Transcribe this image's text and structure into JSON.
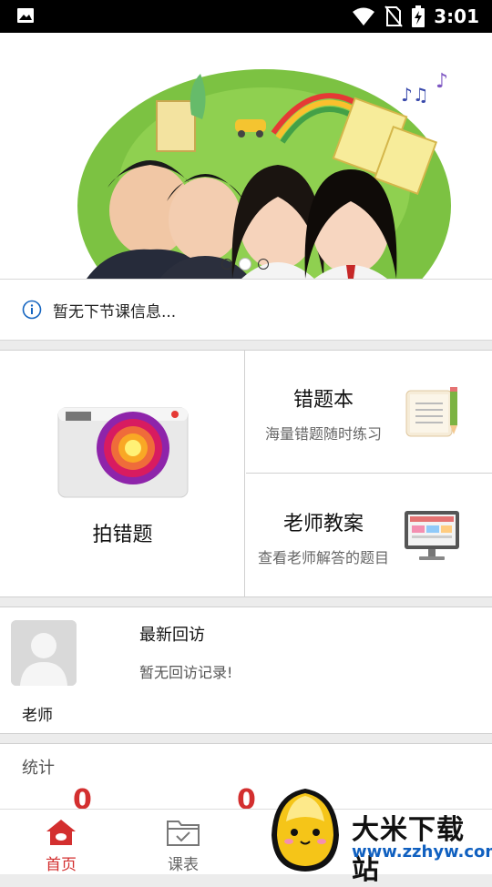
{
  "status_bar": {
    "time": "3:01",
    "icons": [
      "image-icon",
      "wifi-icon",
      "no-sim-icon",
      "battery-charging-icon"
    ]
  },
  "banner": {
    "slides": 3,
    "active_slide_index": 1,
    "image": "students-banner-illustration"
  },
  "next_class": {
    "icon": "info-icon",
    "text": "暂无下节课信息..."
  },
  "features": {
    "photo_mistakes": {
      "label": "拍错题",
      "icon": "camera-icon"
    },
    "mistake_book": {
      "title": "错题本",
      "subtitle": "海量错题随时练习",
      "icon": "notebook-icon"
    },
    "teacher_plans": {
      "title": "老师教案",
      "subtitle": "查看老师解答的题目",
      "icon": "monitor-icon"
    }
  },
  "visit": {
    "teacher_label": "老师",
    "title": "最新回访",
    "empty_text": "暂无回访记录!"
  },
  "stats": {
    "title": "统计",
    "values": [
      "0",
      "0"
    ]
  },
  "tabs": [
    {
      "label": "首页",
      "icon": "home-icon",
      "active": true
    },
    {
      "label": "课表",
      "icon": "schedule-icon",
      "active": false
    }
  ],
  "watermark": {
    "title": "大米下载站",
    "url": "www.zzhyw.com"
  },
  "colors": {
    "accent": "#d32f2f",
    "info_blue": "#1565c0",
    "url_blue": "#1060c0"
  }
}
